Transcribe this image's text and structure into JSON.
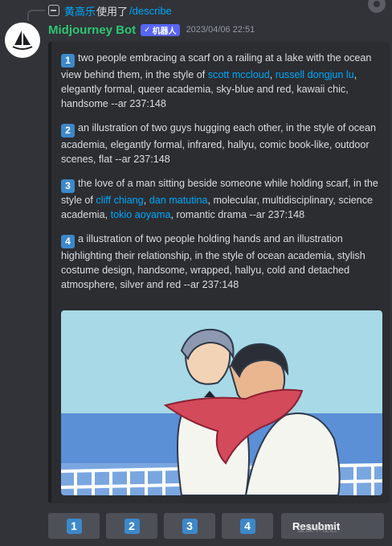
{
  "reply": {
    "user": "黄高乐",
    "used": "使用了",
    "command": "/describe"
  },
  "author": {
    "name": "Midjourney Bot",
    "badge": "机器人",
    "badge_check": "✓",
    "timestamp": "2023/04/06 22:51"
  },
  "prompts": [
    {
      "num": "1",
      "parts": [
        {
          "t": "two people embracing a scarf on a railing at a lake with the ocean view behind them, in the style of ",
          "link": false
        },
        {
          "t": "scott mccloud",
          "link": true
        },
        {
          "t": ", ",
          "link": false
        },
        {
          "t": "russell dongjun lu",
          "link": true
        },
        {
          "t": ", elegantly formal, queer academia, sky-blue and red, kawaii chic, handsome --ar 237:148",
          "link": false
        }
      ]
    },
    {
      "num": "2",
      "parts": [
        {
          "t": "an illustration of two guys hugging each other, in the style of ocean academia, elegantly formal, infrared, hallyu, comic book-like, outdoor scenes, flat --ar 237:148",
          "link": false
        }
      ]
    },
    {
      "num": "3",
      "parts": [
        {
          "t": "the love of a man sitting beside someone while holding scarf, in the style of ",
          "link": false
        },
        {
          "t": "cliff chiang",
          "link": true
        },
        {
          "t": ", ",
          "link": false
        },
        {
          "t": "dan matutina",
          "link": true
        },
        {
          "t": ", molecular, multidisciplinary, science academia, ",
          "link": false
        },
        {
          "t": "tokio aoyama",
          "link": true
        },
        {
          "t": ", romantic drama --ar 237:148",
          "link": false
        }
      ]
    },
    {
      "num": "4",
      "parts": [
        {
          "t": "a illustration of two people holding hands and an illustration highlighting their relationship, in the style of ocean academia, stylish costume design, handsome, wrapped, hallyu, cold and detached atmosphere, silver and red --ar 237:148",
          "link": false
        }
      ]
    }
  ],
  "buttons": {
    "b1": "1",
    "b2": "2",
    "b3": "3",
    "b4": "4",
    "resubmit": "Resubmit"
  },
  "watermark": "金技术社区",
  "colors": {
    "background": "#313338",
    "embed_bg": "#2b2d31",
    "link": "#00a8fc",
    "bot_name": "#2dc770",
    "bot_badge": "#5865f2",
    "number_badge": "#3d88c9",
    "button": "#4e5058"
  },
  "icons": [
    "reply-command-icon",
    "midjourney-sailboat-icon",
    "verified-check-icon",
    "emoji-react-icon"
  ]
}
